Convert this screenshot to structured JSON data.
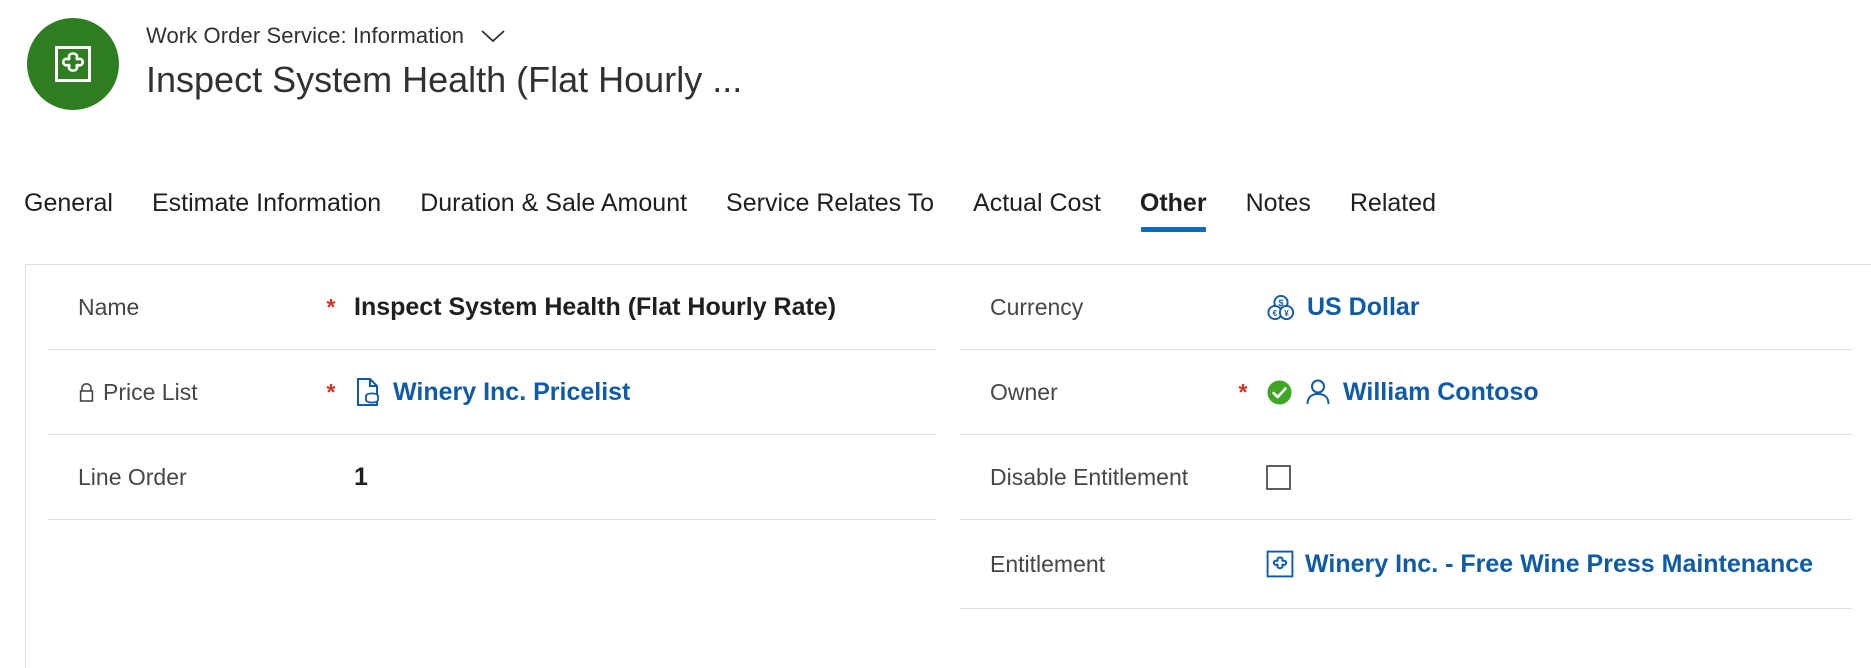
{
  "header": {
    "entity_icon": "entitlement-puzzle-icon",
    "entity_icon_color": "#2e7d20",
    "breadcrumb": "Work Order Service: Information",
    "chevron_icon": "chevron-down-icon",
    "record_title": "Inspect System Health (Flat Hourly ..."
  },
  "tabs": [
    {
      "label": "General",
      "active": false
    },
    {
      "label": "Estimate Information",
      "active": false
    },
    {
      "label": "Duration & Sale Amount",
      "active": false
    },
    {
      "label": "Service Relates To",
      "active": false
    },
    {
      "label": "Actual Cost",
      "active": false
    },
    {
      "label": "Other",
      "active": true
    },
    {
      "label": "Notes",
      "active": false
    },
    {
      "label": "Related",
      "active": false
    }
  ],
  "accent_color": "#0f6cbd",
  "link_color": "#0f5ba7",
  "required_marker": "*",
  "form": {
    "left_column": [
      {
        "label": "Name",
        "required": true,
        "locked": false,
        "value": "Inspect System Health (Flat Hourly Rate)",
        "value_type": "text",
        "icon": null
      },
      {
        "label": "Price List",
        "required": true,
        "locked": true,
        "lock_icon": "lock-icon",
        "value": "Winery Inc. Pricelist",
        "value_type": "link",
        "icon": "price-list-icon"
      },
      {
        "label": "Line Order",
        "required": false,
        "locked": false,
        "value": "1",
        "value_type": "text",
        "icon": null
      }
    ],
    "right_column": [
      {
        "label": "Currency",
        "required": false,
        "locked": false,
        "value": "US Dollar",
        "value_type": "link",
        "icon": "currency-coins-icon"
      },
      {
        "label": "Owner",
        "required": true,
        "locked": false,
        "value": "William Contoso",
        "value_type": "link",
        "icon": "person-icon",
        "status_icon": "green-check-icon",
        "status_color": "#3fa524"
      },
      {
        "label": "Disable Entitlement",
        "required": false,
        "locked": false,
        "value": "",
        "value_type": "checkbox",
        "checked": false
      },
      {
        "label": "Entitlement",
        "required": false,
        "locked": false,
        "value": "Winery Inc. - Free Wine Press Maintenance",
        "value_type": "link",
        "icon": "entitlement-puzzle-icon"
      }
    ]
  }
}
